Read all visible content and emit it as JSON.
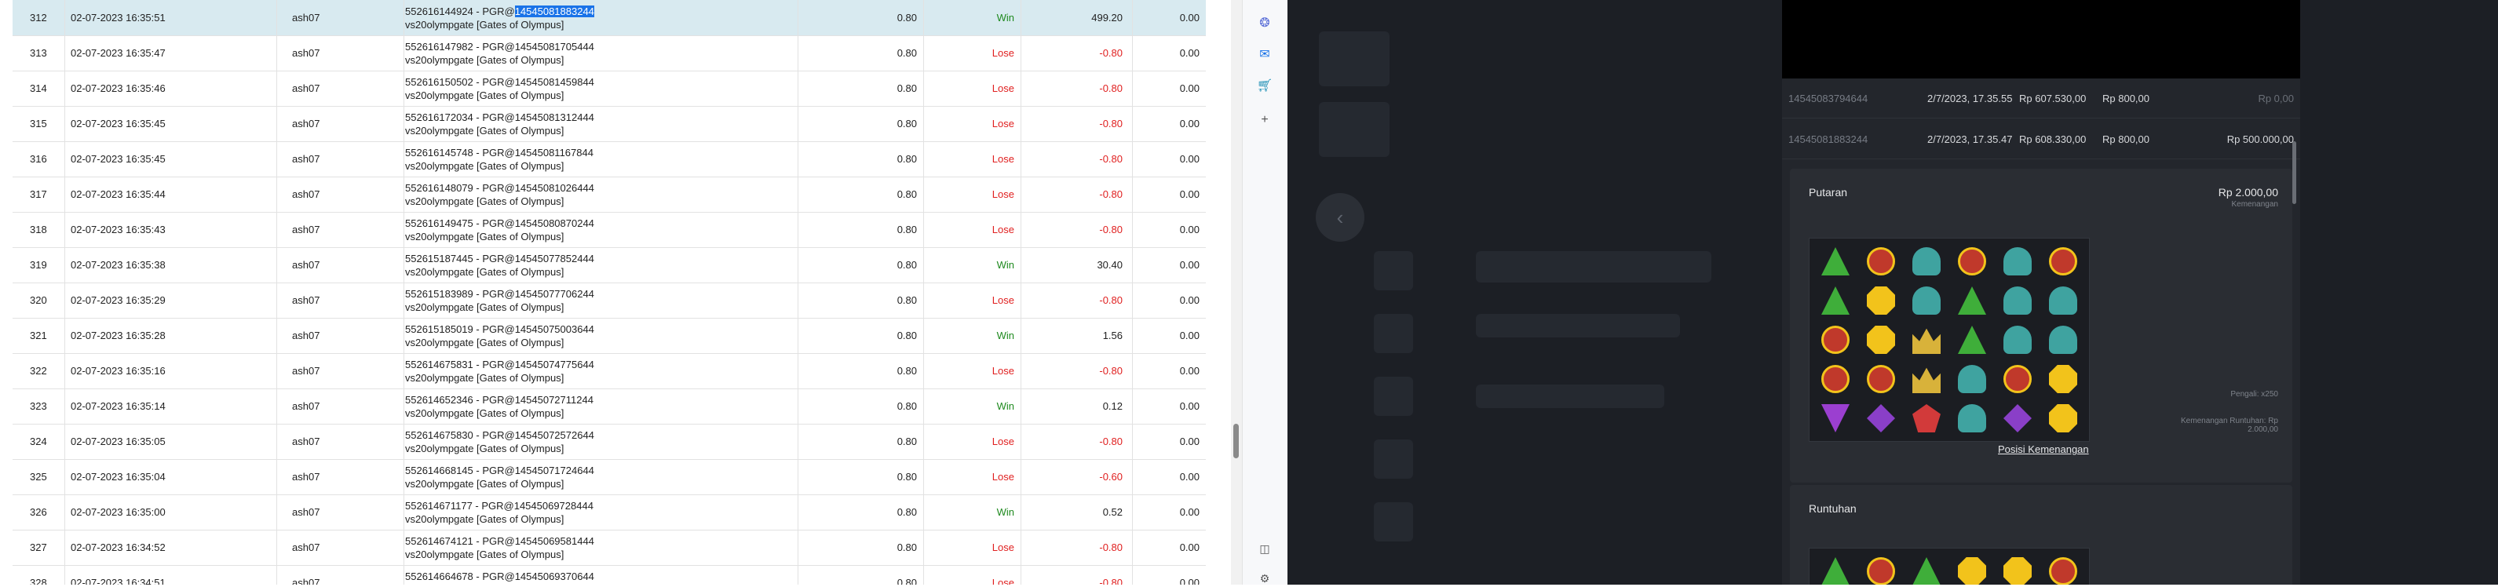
{
  "table": {
    "rows": [
      {
        "no": "312",
        "datetime": "02-07-2023 16:35:51",
        "user": "ash07",
        "info_prefix": "552616144924 - PGR@",
        "info_id": "14545081883244",
        "info_id_highlighted": true,
        "game": "vs20olympgate [Gates of Olympus]",
        "bet": "0.80",
        "result": "Win",
        "payout": "499.20",
        "extra": "0.00",
        "selected": true
      },
      {
        "no": "313",
        "datetime": "02-07-2023 16:35:47",
        "user": "ash07",
        "info_prefix": "552616147982 - PGR@",
        "info_id": "14545081705444",
        "game": "vs20olympgate [Gates of Olympus]",
        "bet": "0.80",
        "result": "Lose",
        "payout": "-0.80",
        "extra": "0.00"
      },
      {
        "no": "314",
        "datetime": "02-07-2023 16:35:46",
        "user": "ash07",
        "info_prefix": "552616150502 - PGR@",
        "info_id": "14545081459844",
        "game": "vs20olympgate [Gates of Olympus]",
        "bet": "0.80",
        "result": "Lose",
        "payout": "-0.80",
        "extra": "0.00"
      },
      {
        "no": "315",
        "datetime": "02-07-2023 16:35:45",
        "user": "ash07",
        "info_prefix": "552616172034 - PGR@",
        "info_id": "14545081312444",
        "game": "vs20olympgate [Gates of Olympus]",
        "bet": "0.80",
        "result": "Lose",
        "payout": "-0.80",
        "extra": "0.00"
      },
      {
        "no": "316",
        "datetime": "02-07-2023 16:35:45",
        "user": "ash07",
        "info_prefix": "552616145748 - PGR@",
        "info_id": "14545081167844",
        "game": "vs20olympgate [Gates of Olympus]",
        "bet": "0.80",
        "result": "Lose",
        "payout": "-0.80",
        "extra": "0.00"
      },
      {
        "no": "317",
        "datetime": "02-07-2023 16:35:44",
        "user": "ash07",
        "info_prefix": "552616148079 - PGR@",
        "info_id": "14545081026444",
        "game": "vs20olympgate [Gates of Olympus]",
        "bet": "0.80",
        "result": "Lose",
        "payout": "-0.80",
        "extra": "0.00"
      },
      {
        "no": "318",
        "datetime": "02-07-2023 16:35:43",
        "user": "ash07",
        "info_prefix": "552616149475 - PGR@",
        "info_id": "14545080870244",
        "game": "vs20olympgate [Gates of Olympus]",
        "bet": "0.80",
        "result": "Lose",
        "payout": "-0.80",
        "extra": "0.00"
      },
      {
        "no": "319",
        "datetime": "02-07-2023 16:35:38",
        "user": "ash07",
        "info_prefix": "552615187445 - PGR@",
        "info_id": "14545077852444",
        "game": "vs20olympgate [Gates of Olympus]",
        "bet": "0.80",
        "result": "Win",
        "payout": "30.40",
        "extra": "0.00"
      },
      {
        "no": "320",
        "datetime": "02-07-2023 16:35:29",
        "user": "ash07",
        "info_prefix": "552615183989 - PGR@",
        "info_id": "14545077706244",
        "game": "vs20olympgate [Gates of Olympus]",
        "bet": "0.80",
        "result": "Lose",
        "payout": "-0.80",
        "extra": "0.00"
      },
      {
        "no": "321",
        "datetime": "02-07-2023 16:35:28",
        "user": "ash07",
        "info_prefix": "552615185019 - PGR@",
        "info_id": "14545075003644",
        "game": "vs20olympgate [Gates of Olympus]",
        "bet": "0.80",
        "result": "Win",
        "payout": "1.56",
        "extra": "0.00"
      },
      {
        "no": "322",
        "datetime": "02-07-2023 16:35:16",
        "user": "ash07",
        "info_prefix": "552614675831 - PGR@",
        "info_id": "14545074775644",
        "game": "vs20olympgate [Gates of Olympus]",
        "bet": "0.80",
        "result": "Lose",
        "payout": "-0.80",
        "extra": "0.00"
      },
      {
        "no": "323",
        "datetime": "02-07-2023 16:35:14",
        "user": "ash07",
        "info_prefix": "552614652346 - PGR@",
        "info_id": "14545072711244",
        "game": "vs20olympgate [Gates of Olympus]",
        "bet": "0.80",
        "result": "Win",
        "payout": "0.12",
        "extra": "0.00"
      },
      {
        "no": "324",
        "datetime": "02-07-2023 16:35:05",
        "user": "ash07",
        "info_prefix": "552614675830 - PGR@",
        "info_id": "14545072572644",
        "game": "vs20olympgate [Gates of Olympus]",
        "bet": "0.80",
        "result": "Lose",
        "payout": "-0.80",
        "extra": "0.00"
      },
      {
        "no": "325",
        "datetime": "02-07-2023 16:35:04",
        "user": "ash07",
        "info_prefix": "552614668145 - PGR@",
        "info_id": "14545071724644",
        "game": "vs20olympgate [Gates of Olympus]",
        "bet": "0.80",
        "result": "Lose",
        "payout": "-0.60",
        "extra": "0.00"
      },
      {
        "no": "326",
        "datetime": "02-07-2023 16:35:00",
        "user": "ash07",
        "info_prefix": "552614671177 - PGR@",
        "info_id": "14545069728444",
        "game": "vs20olympgate [Gates of Olympus]",
        "bet": "0.80",
        "result": "Win",
        "payout": "0.52",
        "extra": "0.00"
      },
      {
        "no": "327",
        "datetime": "02-07-2023 16:34:52",
        "user": "ash07",
        "info_prefix": "552614674121 - PGR@",
        "info_id": "14545069581444",
        "game": "vs20olympgate [Gates of Olympus]",
        "bet": "0.80",
        "result": "Lose",
        "payout": "-0.80",
        "extra": "0.00"
      },
      {
        "no": "328",
        "datetime": "02-07-2023 16:34:51",
        "user": "ash07",
        "info_prefix": "552614664678 - PGR@",
        "info_id": "14545069370644",
        "game": "vs20olympgate [Gates of Olympus]",
        "bet": "0.80",
        "result": "Lose",
        "payout": "-0.80",
        "extra": "0.00"
      }
    ],
    "scroll_position": 0.73
  },
  "colors": {
    "win": "#1f8a1f",
    "lose": "#e02020",
    "selected_row": "#d8eaf0",
    "overlay_bg": "#1c1f25",
    "panel_bg": "#23262c",
    "card_bg": "#2a2d33"
  },
  "side_strip": {
    "icons": [
      "copilot-icon",
      "outlook-icon",
      "shopping-icon",
      "add-icon",
      "sidebar-toggle-icon",
      "settings-icon"
    ]
  },
  "detail_panel": {
    "rows": [
      {
        "id": "14545083794644",
        "date": "2/7/2023, 17.35.55",
        "balance": "Rp 607.530,00",
        "bet": "Rp 800,00",
        "win": "Rp 0,00"
      },
      {
        "id": "14545081883244",
        "date": "2/7/2023, 17.35.47",
        "balance": "Rp 608.330,00",
        "bet": "Rp 800,00",
        "win": "Rp 500.000,00"
      }
    ],
    "spin_card": {
      "title": "Putaran",
      "amount": "Rp 2.000,00",
      "amount_label": "Kemenangan",
      "multiplier_label": "Pengali: x250",
      "cascade_win_label": "Kemenangan Runtuhan: Rp 2.000,00",
      "link": "Posisi Kemenangan",
      "grid": [
        [
          "green",
          "multi",
          "cup",
          "orb",
          "cup",
          "orb"
        ],
        [
          "green",
          "yellow",
          "cup",
          "green",
          "cup",
          "cup"
        ],
        [
          "orb",
          "yellow",
          "crown",
          "green",
          "cup",
          "cup"
        ],
        [
          "orb",
          "orb",
          "crown",
          "cup",
          "orb",
          "yellow"
        ],
        [
          "inv",
          "purple",
          "red",
          "cup",
          "purple",
          "yellow"
        ]
      ]
    },
    "tumble_card": {
      "title": "Runtuhan",
      "grid": [
        [
          "green",
          "multi",
          "green",
          "yellow",
          "yellow",
          "orb"
        ]
      ]
    }
  }
}
